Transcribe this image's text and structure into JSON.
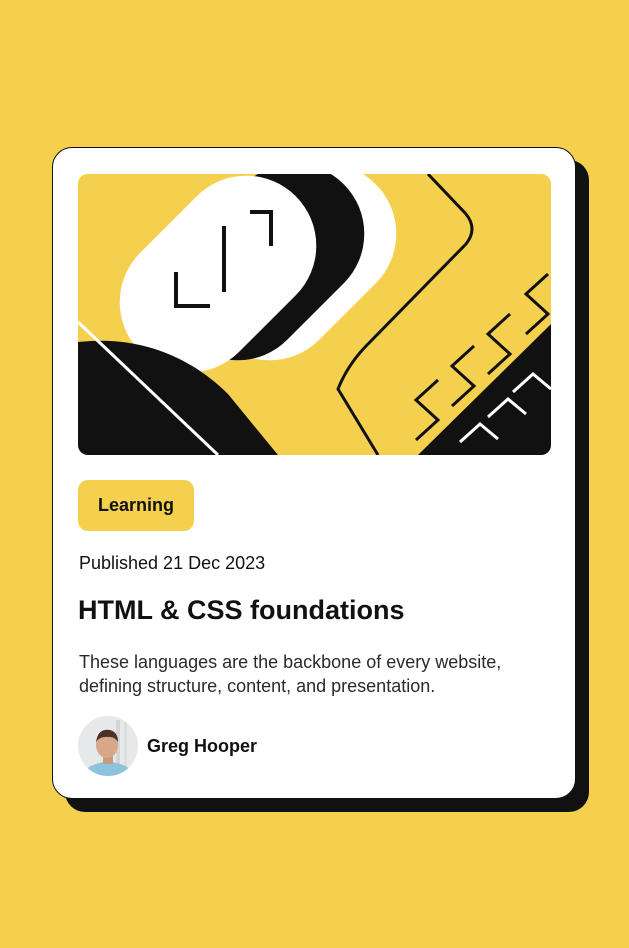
{
  "colors": {
    "background": "#f4d04e",
    "card": "#ffffff",
    "ink": "#111111",
    "accent": "#f4d04e"
  },
  "card": {
    "illustration": "abstract-geometric-illustration",
    "tag": "Learning",
    "published": "Published 21 Dec 2023",
    "title": "HTML & CSS foundations",
    "description": "These languages are the backbone of every website, defining structure, content, and presentation.",
    "author": {
      "name": "Greg Hooper",
      "avatar_icon": "avatar-photo"
    }
  }
}
